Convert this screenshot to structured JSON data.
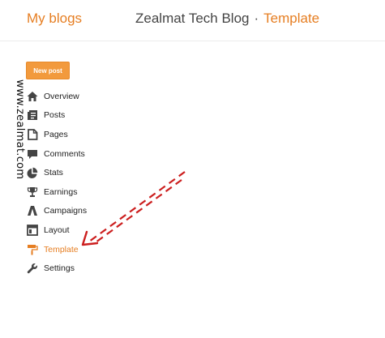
{
  "header": {
    "my_blogs": "My blogs",
    "blog_name": "Zealmat Tech Blog",
    "separator": "·",
    "section": "Template"
  },
  "watermark": "www.zealmat.com",
  "new_post_label": "New post",
  "nav": {
    "items": [
      {
        "label": "Overview",
        "icon": "home-icon"
      },
      {
        "label": "Posts",
        "icon": "posts-icon"
      },
      {
        "label": "Pages",
        "icon": "pages-icon"
      },
      {
        "label": "Comments",
        "icon": "comments-icon"
      },
      {
        "label": "Stats",
        "icon": "stats-icon"
      },
      {
        "label": "Earnings",
        "icon": "trophy-icon"
      },
      {
        "label": "Campaigns",
        "icon": "campaigns-icon"
      },
      {
        "label": "Layout",
        "icon": "layout-icon"
      },
      {
        "label": "Template",
        "icon": "paint-roller-icon",
        "active": true
      },
      {
        "label": "Settings",
        "icon": "wrench-icon"
      }
    ]
  },
  "colors": {
    "accent": "#e67e22",
    "button": "#f29a3d",
    "arrow": "#cc1f1f",
    "icon": "#444444"
  }
}
